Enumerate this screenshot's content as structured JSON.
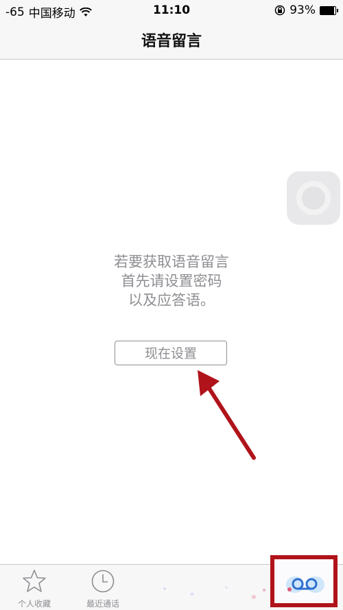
{
  "status_bar": {
    "signal": "-65",
    "carrier": "中国移动",
    "wifi_icon": "wifi-icon",
    "time": "11:10",
    "lock_icon": "orientation-lock-icon",
    "battery_percent": "93%",
    "battery_level": 0.93
  },
  "nav": {
    "title": "语音留言"
  },
  "main": {
    "message_lines": [
      "若要获取语音留言",
      "首先请设置密码",
      "以及应答语。"
    ],
    "setup_button_label": "现在设置"
  },
  "tab_bar": {
    "tabs": [
      {
        "label": "个人收藏",
        "icon": "star-icon"
      },
      {
        "label": "最近通话",
        "icon": "clock-icon"
      }
    ],
    "voicemail_icon": "voicemail-icon"
  },
  "colors": {
    "accent_arrow": "#b0131a",
    "gray_text": "#8e8e93"
  }
}
